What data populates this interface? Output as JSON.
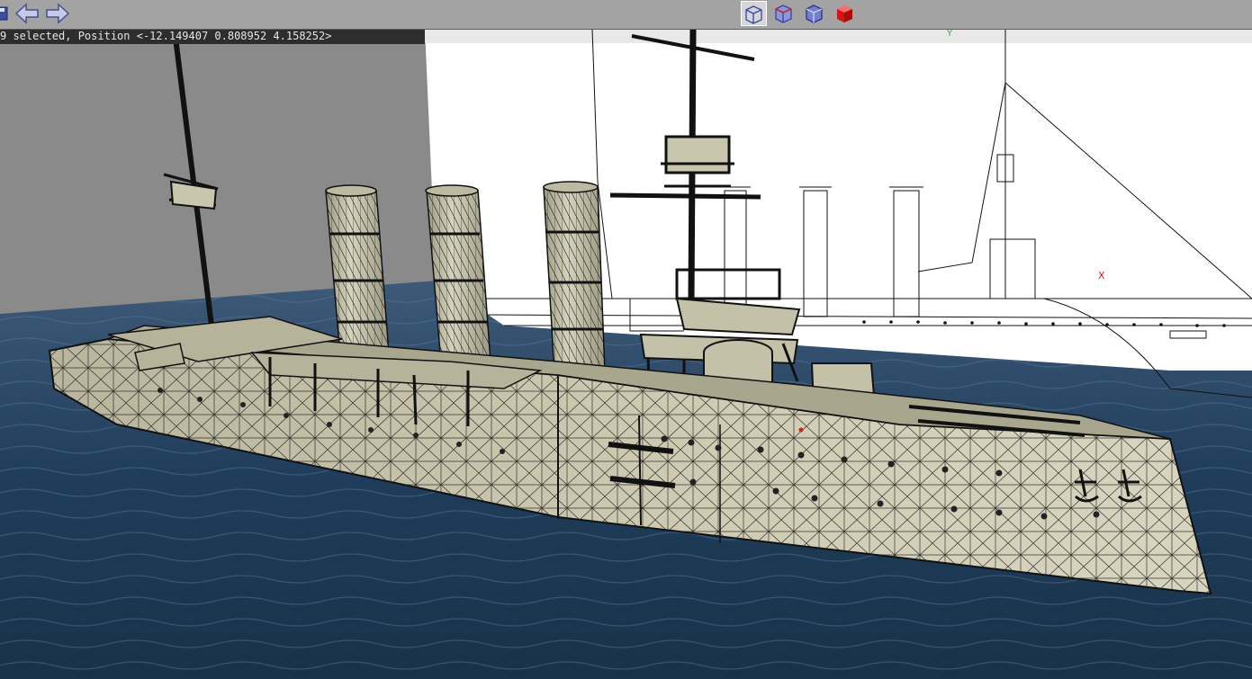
{
  "status": {
    "selection_text": "9 selected, Position <-12.149407 0.808952 4.158252>"
  },
  "toolbar": {
    "save_icon": "save-icon",
    "back_icon": "arrow-left-icon",
    "forward_icon": "arrow-right-icon",
    "view_modes": [
      {
        "name": "wireframe-cube-icon",
        "active": true
      },
      {
        "name": "wireframe-red-edges-cube-icon",
        "active": false
      },
      {
        "name": "shaded-wireframe-cube-icon",
        "active": false
      },
      {
        "name": "solid-red-cube-icon",
        "active": false
      }
    ]
  },
  "viewport": {
    "axis_y_label": "Y",
    "axis_x_label": "X"
  },
  "colors": {
    "toolbar_bg": "#a3a3a3",
    "status_bg": "#2d2d2d",
    "sea": "#1f3d5a",
    "backdrop_gray": "#8a8a8a",
    "hull": "#c9c6ae",
    "wire": "#111111",
    "axis_green": "#2fae2f",
    "axis_red": "#d42020"
  }
}
